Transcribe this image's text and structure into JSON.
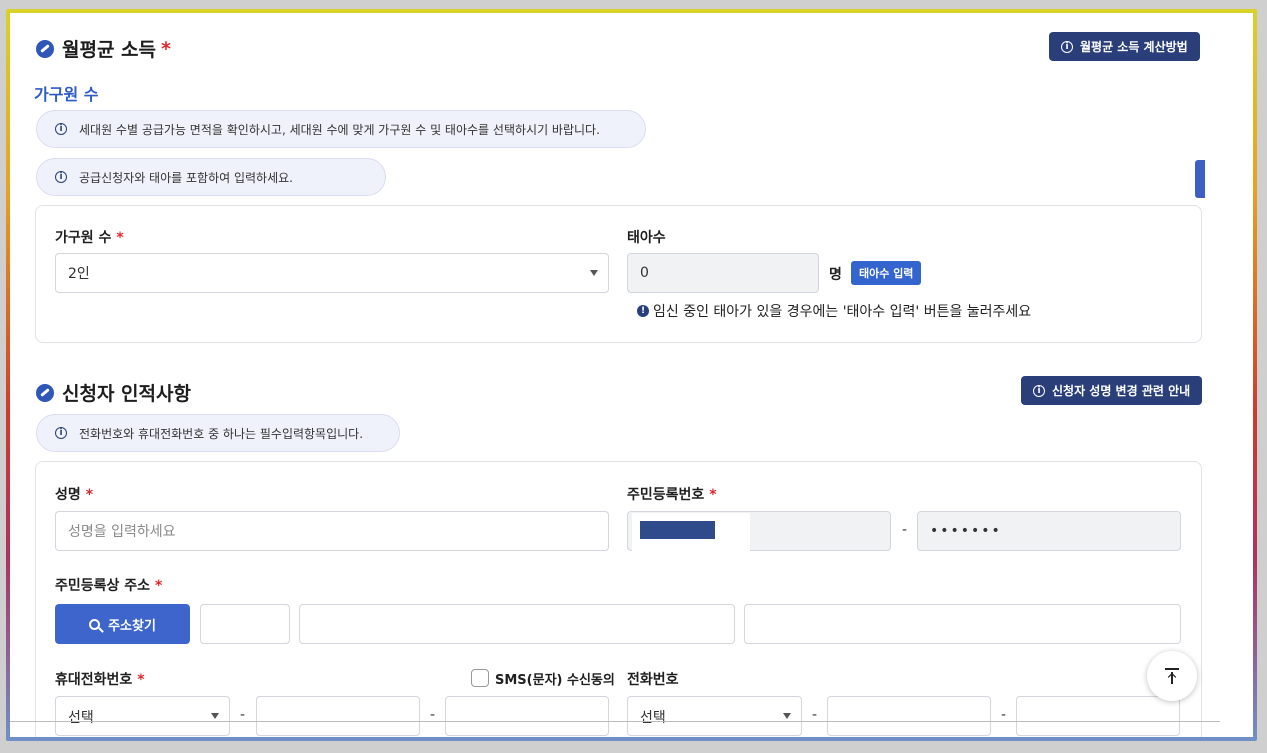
{
  "income": {
    "title": "월평균 소득",
    "req": "*",
    "calc_button": "월평균 소득 계산방법"
  },
  "household": {
    "subhead": "가구원 수",
    "info1": "세대원 수별 공급가능 면적을 확인하시고, 세대원 수에 맞게 가구원 수 및 태아수를 선택하시기 바랍니다.",
    "info2": "공급신청자와 태아를 포함하여 입력하세요.",
    "members_label": "가구원 수",
    "members_req": "*",
    "members_value": "2인",
    "fetus_label": "태아수",
    "fetus_value": "0",
    "fetus_unit": "명",
    "fetus_button": "태아수 입력",
    "fetus_note": "임신 중인 태아가 있을 경우에는 '태아수 입력' 버튼을 눌러주세요"
  },
  "applicant": {
    "title": "신청자 인적사항",
    "name_change_button": "신청자 성명 변경 관련 안내",
    "info": "전화번호와 휴대전화번호 중 하나는 필수입력항목입니다.",
    "name_label": "성명",
    "name_placeholder": "성명을 입력하세요",
    "rrn_label": "주민등록번호",
    "rrn_dash": "-",
    "rrn_back": "•••••••",
    "address_label": "주민등록상 주소",
    "address_button": "주소찾기",
    "mobile_label": "휴대전화번호",
    "mobile_select": "선택",
    "sms_label": "SMS(문자) 수신동의",
    "phone_label": "전화번호",
    "phone_select": "선택",
    "req": "*",
    "dash": "-"
  },
  "colors": {
    "navy": "#2a3f7a",
    "accent": "#3465cf",
    "required": "#e0262b"
  }
}
